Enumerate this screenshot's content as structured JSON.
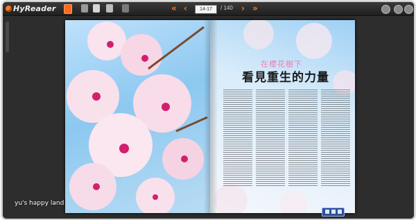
{
  "app": {
    "name": "HyReader"
  },
  "toolbar": {
    "page_input_value": "14-17",
    "page_total": "/ 140",
    "first_label": "«",
    "prev_label": "‹",
    "next_label": "›",
    "last_label": "»",
    "icons": [
      "home-icon",
      "grid-icon",
      "doc-icon",
      "page-icon",
      "tool-icon",
      "settings-icon",
      "cloud-icon",
      "close-icon"
    ]
  },
  "magazine": {
    "kicker": "在櫻花樹下",
    "title": "看見重生的力量",
    "colors": {
      "kicker": "#f27bb5",
      "title": "#1a1a1a",
      "sky": "#6fb2e8",
      "blossom": "#f7d6e6",
      "blossom_center": "#d21f6e"
    }
  },
  "watermark": {
    "text": "yu's happy land"
  }
}
